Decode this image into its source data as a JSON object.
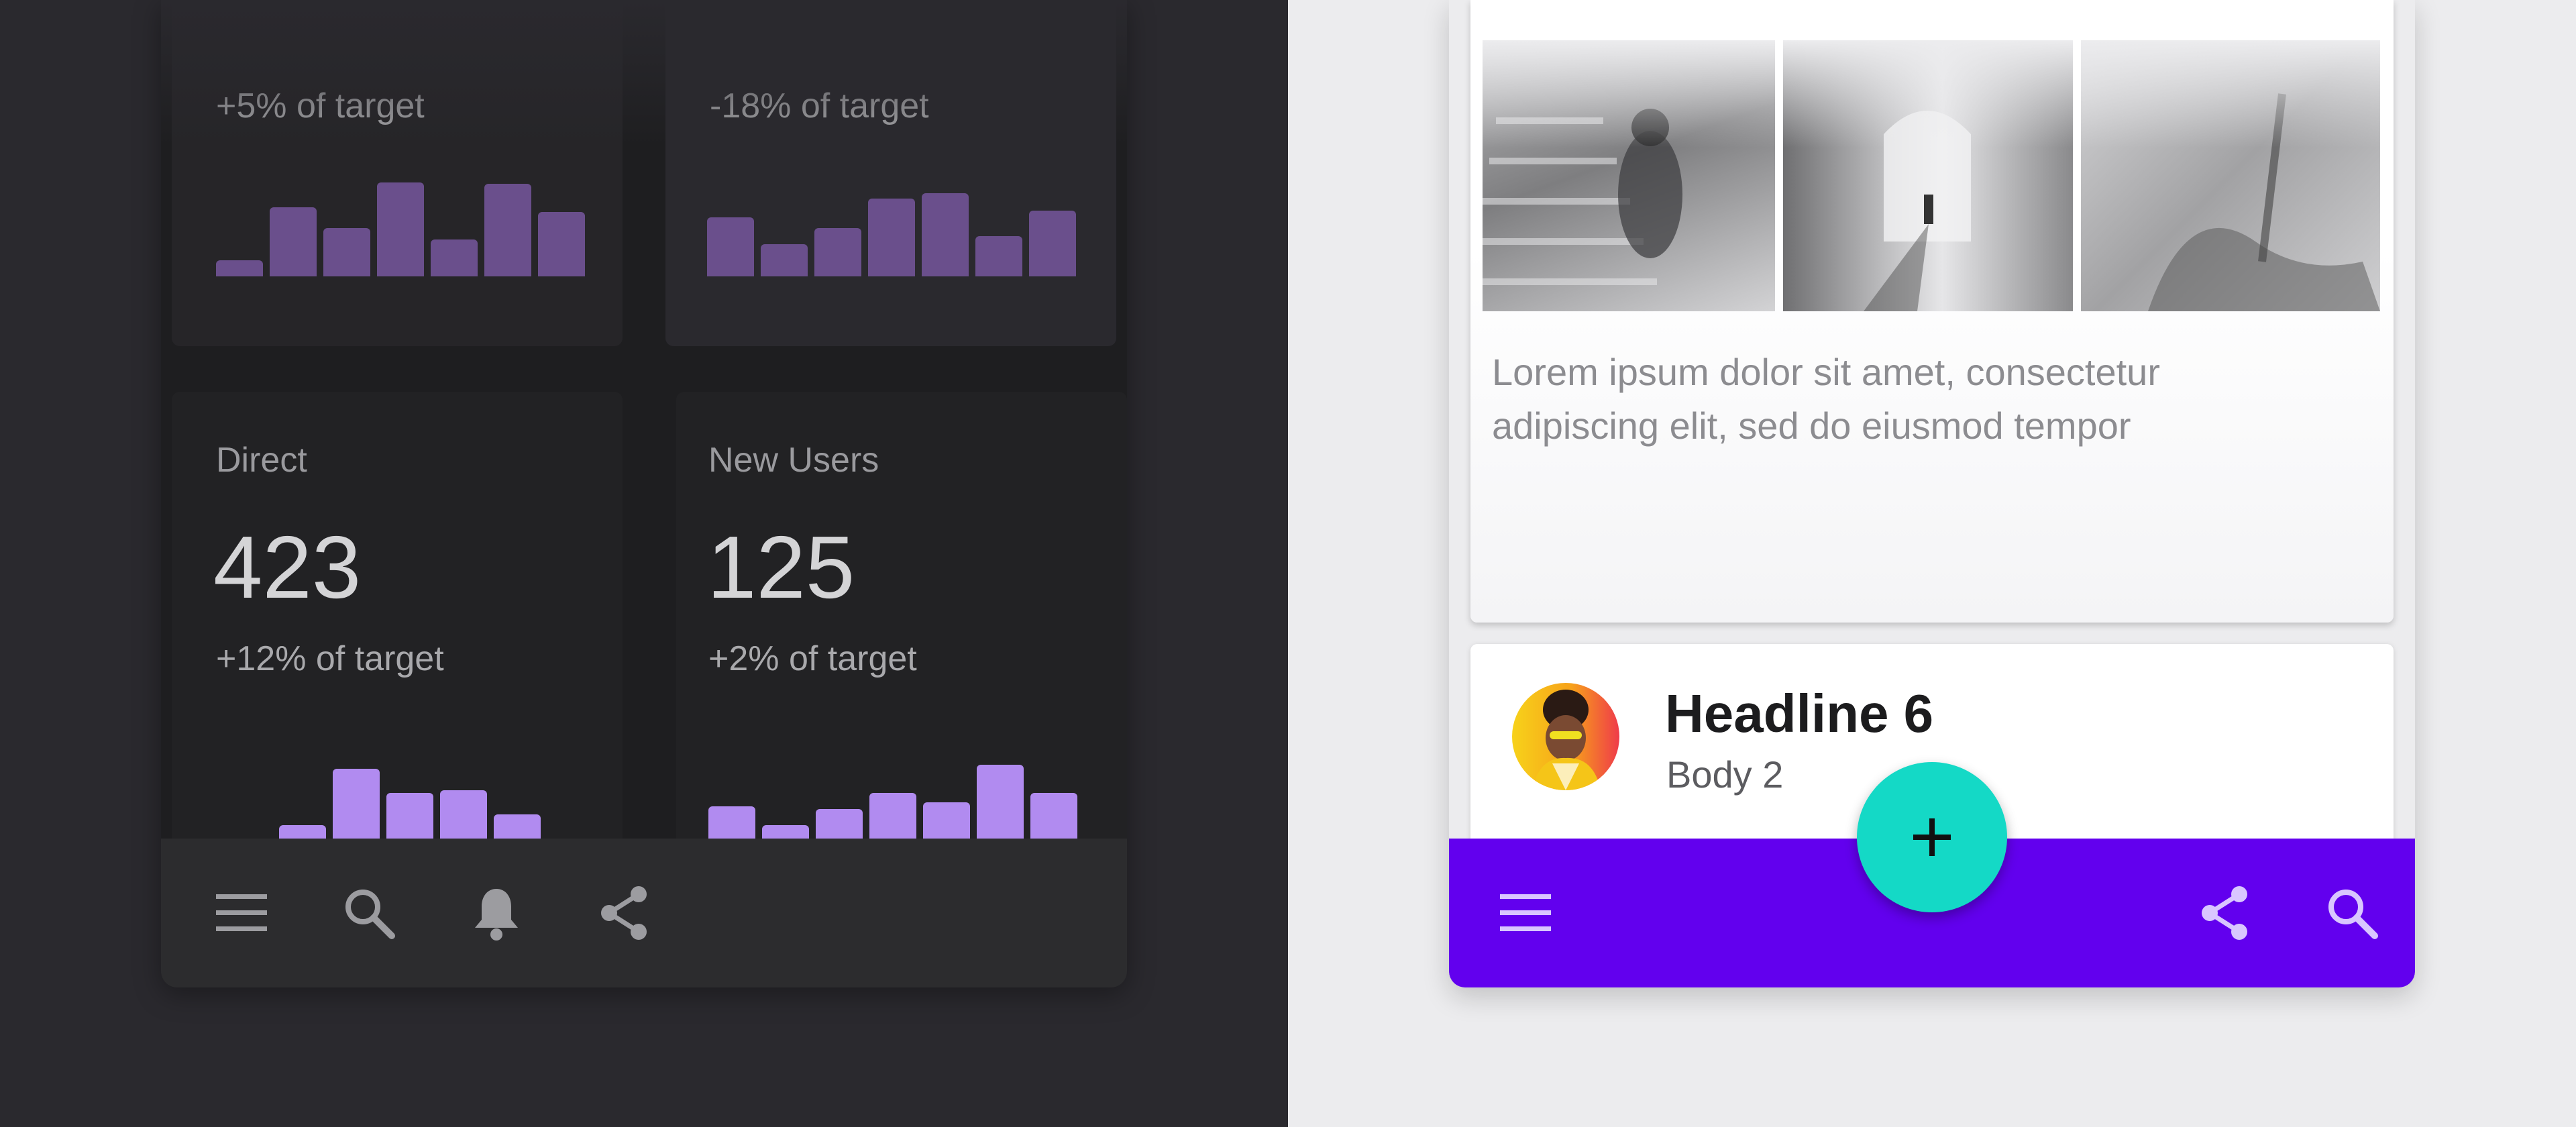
{
  "dashboard": {
    "top_cards": [
      {
        "subtitle": "+5% of target",
        "bars": [
          24,
          103,
          72,
          140,
          55,
          138,
          96
        ]
      },
      {
        "subtitle": "-18% of target",
        "bars": [
          88,
          48,
          72,
          116,
          124,
          60,
          98
        ]
      }
    ],
    "bottom_cards": [
      {
        "label": "Direct",
        "value": "423",
        "subtitle": "+12% of target",
        "bars": [
          20,
          104,
          68,
          72,
          36
        ]
      },
      {
        "label": "New Users",
        "value": "125",
        "subtitle": "+2% of target",
        "bars": [
          48,
          20,
          44,
          68,
          54,
          110,
          68
        ]
      }
    ],
    "bottom_bar_icons": [
      "menu-icon",
      "search-icon",
      "notification-bell-icon",
      "share-icon"
    ]
  },
  "detail": {
    "card_text": "Lorem ipsum dolor sit amet, consectetur adipiscing elit, sed do eiusmod tempor",
    "list_item": {
      "headline": "Headline 6",
      "body": "Body 2"
    },
    "fab_icon": "add-icon",
    "bottom_bar_icons": [
      "menu-icon",
      "share-icon",
      "search-icon"
    ]
  },
  "colors": {
    "primary": "#6200ee",
    "secondary": "#14d9c6",
    "chart_bar_light": "#b18bf0",
    "chart_bar_dim": "#6a4f8c",
    "dark_surface": "#1e1e20"
  }
}
